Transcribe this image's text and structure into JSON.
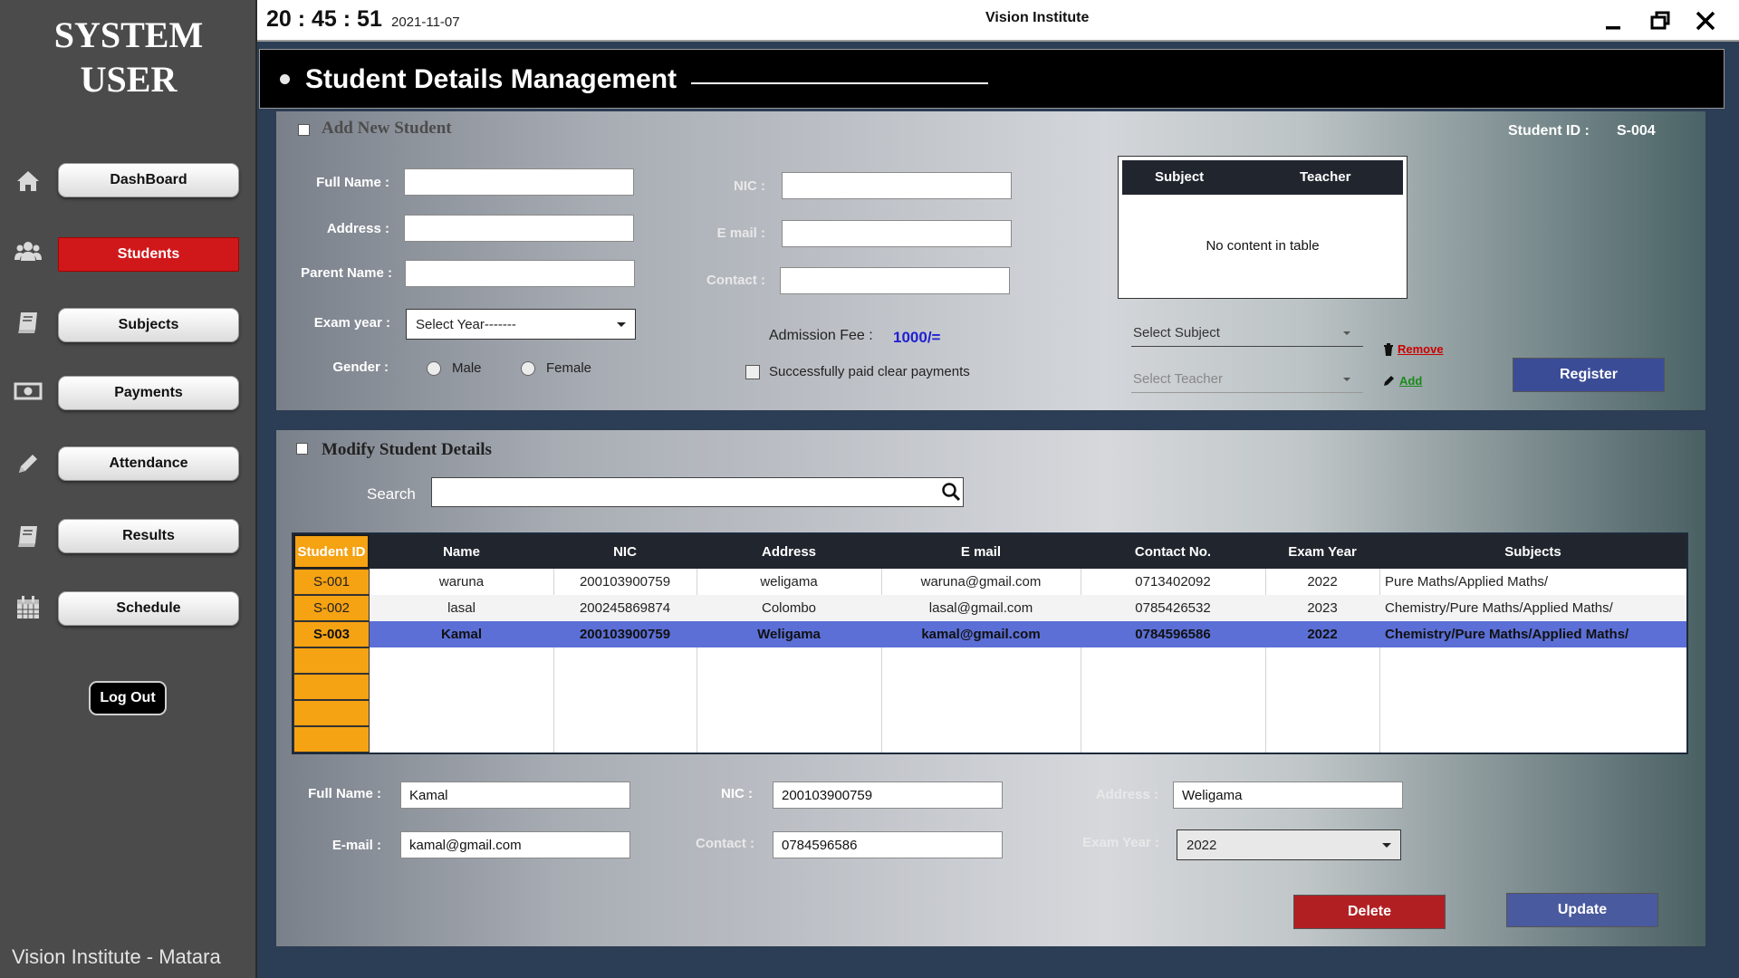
{
  "sidebar": {
    "brand_line1": "SYSTEM",
    "brand_line2": "USER",
    "items": [
      {
        "label": "DashBoard",
        "icon": "home-icon"
      },
      {
        "label": "Students",
        "icon": "users-icon",
        "active": true
      },
      {
        "label": "Subjects",
        "icon": "book-icon"
      },
      {
        "label": "Payments",
        "icon": "money-icon"
      },
      {
        "label": "Attendance",
        "icon": "pencil-icon"
      },
      {
        "label": "Results",
        "icon": "book-icon"
      },
      {
        "label": "Schedule",
        "icon": "calendar-icon"
      }
    ],
    "logout_label": "Log Out",
    "footer": "Vision Institute  - Matara"
  },
  "topbar": {
    "clock": "20 : 45 : 51",
    "date": "2021-11-07",
    "app_title": "Vision Institute"
  },
  "header": {
    "title": "Student Details Management"
  },
  "add_student": {
    "section_title": "Add New Student",
    "student_id_label": "Student ID :",
    "student_id_value": "S-004",
    "full_name_label": "Full Name :",
    "address_label": "Address :",
    "parent_name_label": "Parent Name :",
    "exam_year_label": "Exam year :",
    "exam_year_value": "Select Year-------",
    "gender_label": "Gender :",
    "gender_male": "Male",
    "gender_female": "Female",
    "nic_label": "NIC :",
    "email_label": "E mail :",
    "contact_label": "Contact :",
    "admission_fee_label": "Admission Fee :",
    "admission_fee_value": "1000/=",
    "paid_label": "Successfully paid clear payments",
    "subject_table": {
      "col_subject": "Subject",
      "col_teacher": "Teacher",
      "empty_text": "No content in table"
    },
    "select_subject": "Select Subject",
    "select_teacher": "Select Teacher",
    "remove_label": "Remove",
    "add_label": "Add",
    "register_label": "Register"
  },
  "modify_student": {
    "section_title": "Modify Student Details",
    "search_label": "Search",
    "search_value": "",
    "columns": [
      "Student ID",
      "Name",
      "NIC",
      "Address",
      "E mail",
      "Contact No.",
      "Exam Year",
      "Subjects"
    ],
    "rows": [
      {
        "id": "S-001",
        "name": "waruna",
        "nic": "200103900759",
        "address": "weligama",
        "email": "waruna@gmail.com",
        "contact": "0713402092",
        "year": "2022",
        "subjects": "Pure Maths/Applied Maths/"
      },
      {
        "id": "S-002",
        "name": "lasal",
        "nic": "200245869874",
        "address": "Colombo",
        "email": "lasal@gmail.com",
        "contact": "0785426532",
        "year": "2023",
        "subjects": "Chemistry/Pure Maths/Applied Maths/"
      },
      {
        "id": "S-003",
        "name": "Kamal",
        "nic": "200103900759",
        "address": "Weligama",
        "email": "kamal@gmail.com",
        "contact": "0784596586",
        "year": "2022",
        "subjects": "Chemistry/Pure Maths/Applied Maths/",
        "selected": true
      }
    ],
    "form": {
      "full_name_label": "Full Name :",
      "full_name_value": "Kamal",
      "email_label": "E-mail :",
      "email_value": "kamal@gmail.com",
      "nic_label": "NIC :",
      "nic_value": "200103900759",
      "contact_label": "Contact :",
      "contact_value": "0784596586",
      "address_label": "Address :",
      "address_value": "Weligama",
      "exam_year_label": "Exam Year :",
      "exam_year_value": "2022"
    },
    "delete_label": "Delete",
    "update_label": "Update"
  },
  "colors": {
    "active_nav": "#d0181b",
    "id_column": "#f5a213",
    "selected_row": "#5b6fd6",
    "table_header": "#21262e",
    "register_button": "#3b4c97",
    "delete_button": "#b21f23"
  }
}
